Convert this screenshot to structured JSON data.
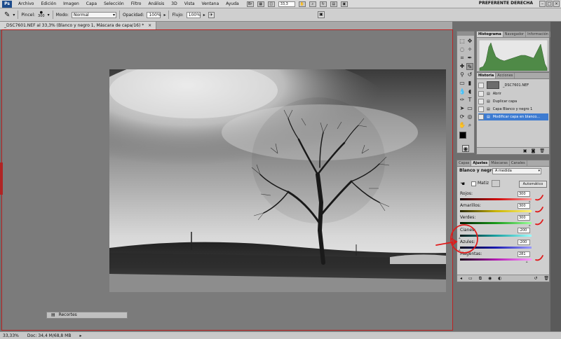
{
  "app_logo": "Ps",
  "menu": [
    "Archivo",
    "Edición",
    "Imagen",
    "Capa",
    "Selección",
    "Filtro",
    "Análisis",
    "3D",
    "Vista",
    "Ventana",
    "Ayuda"
  ],
  "zoom_display": "33,3",
  "workspace": "PREFERENTE DERECHA",
  "options": {
    "brush_label": "Pincel:",
    "brush_size": "300",
    "mode_label": "Modo:",
    "mode_value": "Normal",
    "opacity_label": "Opacidad:",
    "opacity_value": "100%",
    "flow_label": "Flujo:",
    "flow_value": "100%"
  },
  "document_tab": "_DSC7601.NEF al 33,3% (Blanco y negro 1, Máscara de capa/16) *",
  "status": {
    "zoom": "33,33%",
    "doc": "Doc: 34,4 M/68,8 MB"
  },
  "recortes_panel": "Recortes",
  "histogram_panel": {
    "tabs": [
      "Histograma",
      "Navegador",
      "Información"
    ]
  },
  "history_panel": {
    "tabs": [
      "Historia",
      "Acciones"
    ],
    "snapshot": "_DSC7601.NEF",
    "steps": [
      "Abrir",
      "Duplicar capa",
      "Capa Blanco y negro 1",
      "Modificar capa en blanco..."
    ]
  },
  "adjustments_panel": {
    "tabs": [
      "Capas",
      "Ajustes",
      "Máscaras",
      "Canales"
    ],
    "title": "Blanco y negro",
    "preset": "A medida",
    "tint_label": "Matiz",
    "auto_button": "Automático",
    "sliders": [
      {
        "label": "Rojos:",
        "value": "300",
        "position": 1.0
      },
      {
        "label": "Amarillos:",
        "value": "300",
        "position": 1.0
      },
      {
        "label": "Verdes:",
        "value": "300",
        "position": 1.0
      },
      {
        "label": "Cianes:",
        "value": "-200",
        "position": 0.0
      },
      {
        "label": "Azules:",
        "value": "-200",
        "position": 0.0
      },
      {
        "label": "Magentas:",
        "value": "281",
        "position": 0.96
      }
    ]
  },
  "colors": {
    "annotation_red": "#e01b1b",
    "selection_blue": "#3d7bd1"
  }
}
